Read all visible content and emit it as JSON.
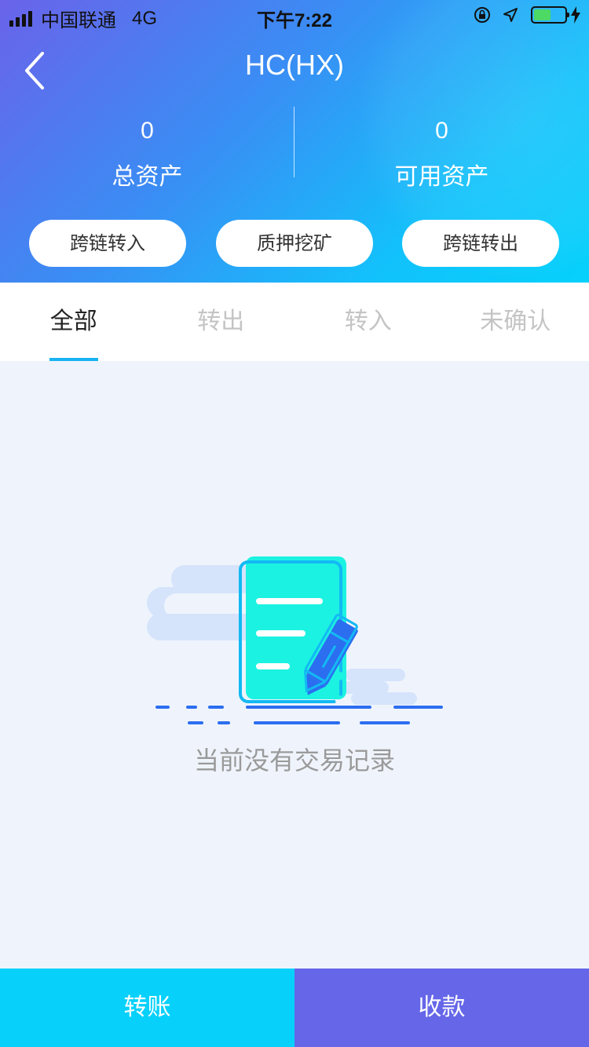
{
  "status_bar": {
    "carrier": "中国联通",
    "network": "4G",
    "time": "下午7:22"
  },
  "header": {
    "title": "HC(HX)",
    "total_assets": {
      "value": "0",
      "label": "总资产"
    },
    "available_assets": {
      "value": "0",
      "label": "可用资产"
    }
  },
  "actions": {
    "cross_chain_in": "跨链转入",
    "staking_mining": "质押挖矿",
    "cross_chain_out": "跨链转出"
  },
  "tabs": [
    {
      "label": "全部"
    },
    {
      "label": "转出"
    },
    {
      "label": "转入"
    },
    {
      "label": "未确认"
    }
  ],
  "active_tab": "全部",
  "empty_state": {
    "message": "当前没有交易记录"
  },
  "footer": {
    "transfer": "转账",
    "receive": "收款"
  },
  "colors": {
    "header_gradient_start": "#6a63ea",
    "header_gradient_end": "#05d1fb",
    "tab_underline": "#17b3f2",
    "transfer_button": "#07d1fb",
    "receive_button": "#6566e8",
    "page_background": "#eff4fc"
  },
  "icons": {
    "back": "chevron-left-icon",
    "empty": "document-pen-icon"
  }
}
